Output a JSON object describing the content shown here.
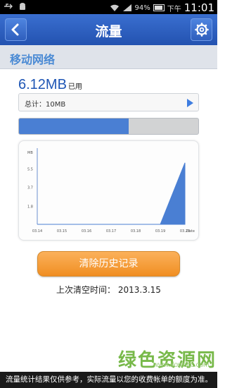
{
  "status_bar": {
    "battery": "94%",
    "period": "下午",
    "time": "11:01",
    "icons": [
      "usb-icon",
      "android-icon",
      "wifi-icon",
      "signal-icon",
      "battery-icon"
    ]
  },
  "header": {
    "title": "流量",
    "back_icon": "chevron-left-icon",
    "settings_icon": "gear-icon"
  },
  "section": {
    "title": "移动网络"
  },
  "usage": {
    "value": "6.12MB",
    "unit": "已用"
  },
  "total": {
    "label": "总计：10MB"
  },
  "progress": {
    "fraction": 0.612
  },
  "chart_data": {
    "type": "area",
    "x": [
      "03.14",
      "03.15",
      "03.16",
      "03.17",
      "03.18",
      "03.19",
      "03.20"
    ],
    "y": [
      0,
      0,
      0,
      0,
      0,
      0,
      6.12
    ],
    "xlabel": "Date",
    "ylabel": "MB",
    "yticks": [
      "1.8",
      "3.7",
      "5.5"
    ],
    "ylim": [
      0,
      7.3
    ],
    "color": "#4a7fd3"
  },
  "clear_button": {
    "label": "清除历史记录"
  },
  "last_clear": {
    "text": "上次清空时间： 2013.3.15"
  },
  "watermark": {
    "main": "绿色资源网",
    "url": "www.downcc.com"
  },
  "notice": {
    "text": "流量统计结果仅供参考，实际流量以您的收费帐单的额度为准。"
  }
}
